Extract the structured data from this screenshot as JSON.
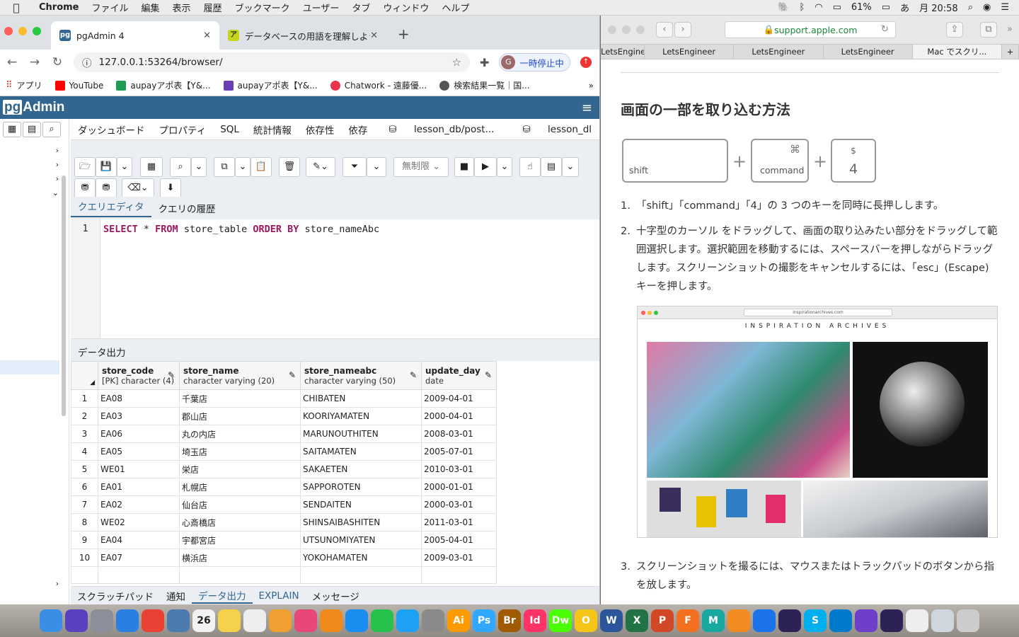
{
  "menubar": {
    "app": "Chrome",
    "items": [
      "ファイル",
      "編集",
      "表示",
      "履歴",
      "ブックマーク",
      "ユーザー",
      "タブ",
      "ウィンドウ",
      "ヘルプ"
    ],
    "battery": "61%",
    "ime": "あ",
    "clock": "月 20:58"
  },
  "chrome": {
    "tabs": [
      {
        "title": "pgAdmin 4",
        "favicon": "pg"
      },
      {
        "title": "データベースの用語を理解しよう",
        "favicon": "ア"
      }
    ],
    "url": "127.0.0.1:53264/browser/",
    "pause_label": "一時停止中",
    "avatar_letter": "G",
    "bookmarks": [
      "アプリ",
      "YouTube",
      "aupayアポ表【Y&...",
      "aupayアポ表【Y&...",
      "Chatwork - 遠藤優...",
      "検索結果一覧｜国..."
    ]
  },
  "pgadmin": {
    "logo_pg": "pg",
    "logo_rest": "Admin",
    "tabs": [
      "ダッシュボード",
      "プロパティ",
      "SQL",
      "統計情報",
      "依存性",
      "依存",
      "lesson_db/post...",
      "lesson_dl"
    ],
    "limit_select": "無制限",
    "query_tabs": [
      "クエリエディタ",
      "クエリの履歴"
    ],
    "line_no": "1",
    "sql": {
      "k1": "SELECT",
      "p1": " * ",
      "k2": "FROM",
      "p2": " store_table ",
      "k3": "ORDER BY",
      "p3": " store_nameAbc"
    },
    "data_output_title": "データ出力",
    "columns": [
      {
        "name": "store_code",
        "type": "[PK] character (4)"
      },
      {
        "name": "store_name",
        "type": "character varying (20)"
      },
      {
        "name": "store_nameabc",
        "type": "character varying (50)"
      },
      {
        "name": "update_day",
        "type": "date"
      }
    ],
    "rows": [
      [
        "1",
        "EA08",
        "千葉店",
        "CHIBATEN",
        "2009-04-01"
      ],
      [
        "2",
        "EA03",
        "郡山店",
        "KOORIYAMATEN",
        "2000-04-01"
      ],
      [
        "3",
        "EA06",
        "丸の内店",
        "MARUNOUTHITEN",
        "2008-03-01"
      ],
      [
        "4",
        "EA05",
        "埼玉店",
        "SAITAMATEN",
        "2005-07-01"
      ],
      [
        "5",
        "WE01",
        "栄店",
        "SAKAETEN",
        "2010-03-01"
      ],
      [
        "6",
        "EA01",
        "札幌店",
        "SAPPOROTEN",
        "2000-01-01"
      ],
      [
        "7",
        "EA02",
        "仙台店",
        "SENDAITEN",
        "2000-03-01"
      ],
      [
        "8",
        "WE02",
        "心斎橋店",
        "SHINSAIBASHITEN",
        "2011-03-01"
      ],
      [
        "9",
        "EA04",
        "宇都宮店",
        "UTSUNOMIYATEN",
        "2005-04-01"
      ],
      [
        "10",
        "EA07",
        "横浜店",
        "YOKOHAMATEN",
        "2009-03-01"
      ]
    ],
    "bottom_tabs": [
      "スクラッチパッド",
      "通知",
      "データ出力",
      "EXPLAIN",
      "メッセージ"
    ]
  },
  "safari": {
    "url": "support.apple.com",
    "tabs": [
      "LetsEngineer",
      "LetsEngineer",
      "LetsEngineer",
      "LetsEngineer",
      "Mac でスクリ..."
    ],
    "heading": "画面の一部を取り込む方法",
    "keys": [
      {
        "top": "",
        "bottom": "shift"
      },
      {
        "top": "⌘",
        "bottom": "command"
      },
      {
        "top": "$",
        "bottom": "4"
      }
    ],
    "steps": [
      "「shift」「command」「4」の 3 つのキーを同時に長押しします。",
      "十字型のカーソル  をドラッグして、画面の取り込みたい部分をドラッグして範囲選択します。選択範囲を移動するには、スペースバーを押しながらドラッグします。スクリーンショットの撮影をキャンセルするには、「esc」(Escape) キーを押します。",
      "スクリーンショットを撮るには、マウスまたはトラックパッドのボタンから指を放します。"
    ],
    "shot_url": "inspirationarchives.com",
    "shot_title": "INSPIRATION ARCHIVES"
  },
  "dock": [
    "finder",
    "siri",
    "launchpad",
    "safari",
    "chrome",
    "preview",
    "calendar",
    "notes",
    "reminders",
    "photos",
    "itunes",
    "books",
    "appstore",
    "line",
    "twitter",
    "sysprefs",
    "illustrator",
    "photoshop",
    "bridge",
    "indesign",
    "dreamweaver",
    "opera",
    "word",
    "excel",
    "powerpoint",
    "fusion360",
    "maya",
    "sublime",
    "maps",
    "eclipse",
    "skype",
    "vscode",
    "github",
    "eclipse2",
    "finder-docs",
    "downloads",
    "trash"
  ]
}
